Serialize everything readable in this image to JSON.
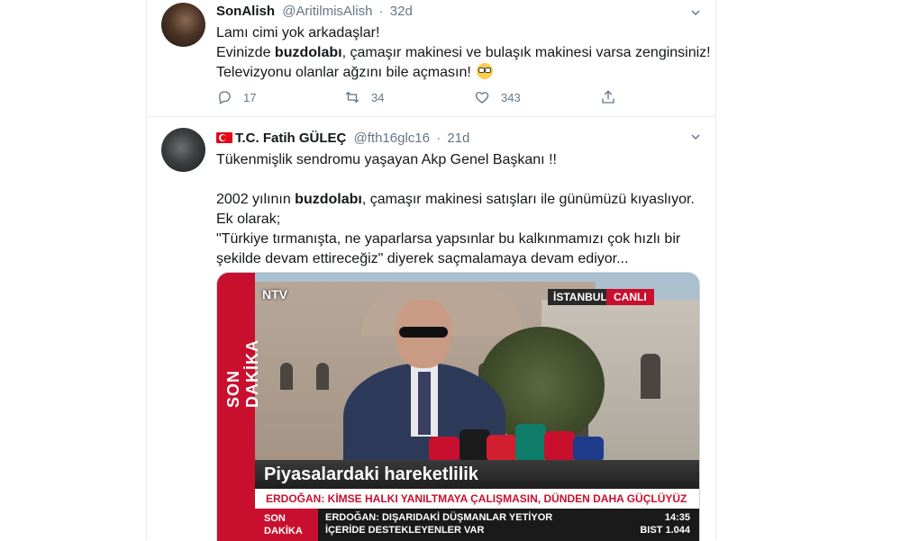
{
  "tweets": [
    {
      "name": "SonAlish",
      "handle": "@AritilmisAlish",
      "time": "32d",
      "lines": [
        "Lamı cimi yok arkadaşlar!",
        {
          "pre": "Evinizde ",
          "bold": "buzdolabı",
          "post": ", çamaşır makinesi ve bulaşık makinesi varsa zenginsiniz!"
        },
        "Televizyonu olanlar ağzını bile açmasın!"
      ],
      "emoji": "nerd-face-emoji",
      "actions": {
        "reply": "17",
        "retweet": "34",
        "like": "343"
      }
    },
    {
      "name": "T.C. Fatih GÜLEÇ",
      "handle": "@fth16glc16",
      "time": "21d",
      "lines": [
        "Tükenmişlik sendromu yaşayan Akp Genel Başkanı !!",
        "",
        {
          "pre": "2002 yılının ",
          "bold": "buzdolabı",
          "post": ", çamaşır makinesi satışları ile günümüzü kıyaslıyor."
        },
        "Ek olarak;",
        "\"Türkiye tırmanışta, ne yaparlarsa yapsınlar bu kalkınmamızı çok hızlı bir",
        "şekilde devam ettireceğiz\" diyerek saçmalamaya devam ediyor..."
      ],
      "media": {
        "logo": "NTV",
        "city": "İSTANBUL",
        "live": "CANLI",
        "side_label": "SON DAKİKA",
        "banner": "Piyasalardaki hareketlilik",
        "ticker_red": "ERDOĞAN: KİMSE HALKI YANILTMAYA ÇALIŞMASIN, DÜNDEN DAHA GÜÇLÜYÜZ",
        "ticker_son_1": "SON",
        "ticker_son_2": "DAKİKA",
        "ticker_news_1": "ERDOĞAN: DIŞARIDAKİ DÜŞMANLAR YETİYOR",
        "ticker_news_2": "İÇERİDE DESTEKLEYENLER VAR",
        "clock": "14:35",
        "bist_label": "BIST",
        "bist_value": "1.044"
      }
    }
  ],
  "colors": {
    "accent": "#1da1f2",
    "muted": "#657786",
    "border": "#e6ecf0",
    "red": "#c8102e"
  }
}
